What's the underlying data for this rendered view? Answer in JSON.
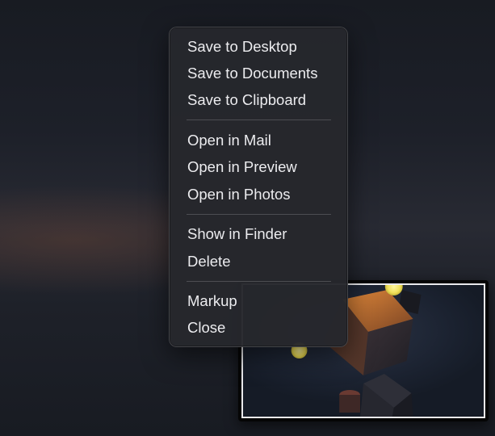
{
  "context_menu": {
    "groups": [
      [
        "Save to Desktop",
        "Save to Documents",
        "Save to Clipboard"
      ],
      [
        "Open in Mail",
        "Open in Preview",
        "Open in Photos"
      ],
      [
        "Show in Finder",
        "Delete"
      ],
      [
        "Markup",
        "Close"
      ]
    ]
  },
  "thumbnail": {
    "icon": "screenshot-preview"
  },
  "colors": {
    "menu_background": "#26272c",
    "menu_text": "#ececef",
    "desktop_background": "#1d2029",
    "glow_orb": "#f2e66a",
    "cube_highlight": "#c8762a"
  }
}
